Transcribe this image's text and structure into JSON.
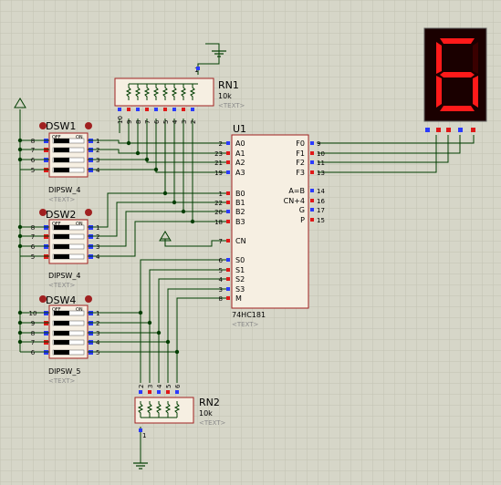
{
  "colors": {
    "background": "#d6d6c8",
    "grid": "#c2c2b2",
    "wire": "#003d00",
    "chip_fill": "#f6efe2",
    "chip_border": "#a02020",
    "pin_blue": "#2a3aff",
    "pin_red": "#e01818",
    "segment_on": "#ff1a1a",
    "segment_off": "#3a0000",
    "display_bg": "#1a0000",
    "text_label": "#000000",
    "text_placeholder": "#8a8a8a",
    "switch_knob": "#000000"
  },
  "rn1": {
    "ref": "RN1",
    "value": "10k",
    "placeholder": "<TEXT>",
    "pin_numbers": [
      "10",
      "9",
      "8",
      "7",
      "6",
      "5",
      "4",
      "3",
      "2"
    ],
    "common_pin": "1"
  },
  "rn2": {
    "ref": "RN2",
    "value": "10k",
    "placeholder": "<TEXT>",
    "pin_numbers": [
      "2",
      "3",
      "4",
      "5",
      "6"
    ],
    "common_pin": "1"
  },
  "u1": {
    "ref": "U1",
    "part": "74HC181",
    "placeholder": "<TEXT>",
    "left_pins": [
      {
        "num": "2",
        "name": "A0"
      },
      {
        "num": "23",
        "name": "A1"
      },
      {
        "num": "21",
        "name": "A2"
      },
      {
        "num": "19",
        "name": "A3"
      },
      {
        "num": "1",
        "name": "B0"
      },
      {
        "num": "22",
        "name": "B1"
      },
      {
        "num": "20",
        "name": "B2"
      },
      {
        "num": "18",
        "name": "B3"
      },
      {
        "num": "7",
        "name": "CN"
      },
      {
        "num": "6",
        "name": "S0"
      },
      {
        "num": "5",
        "name": "S1"
      },
      {
        "num": "4",
        "name": "S2"
      },
      {
        "num": "3",
        "name": "S3"
      },
      {
        "num": "8",
        "name": "M"
      }
    ],
    "right_pins": [
      {
        "num": "9",
        "name": "F0"
      },
      {
        "num": "10",
        "name": "F1"
      },
      {
        "num": "11",
        "name": "F2"
      },
      {
        "num": "13",
        "name": "F3"
      },
      {
        "num": "14",
        "name": "A=B"
      },
      {
        "num": "16",
        "name": "CN+4"
      },
      {
        "num": "17",
        "name": "G"
      },
      {
        "num": "15",
        "name": "P"
      }
    ]
  },
  "dsw1": {
    "ref": "DSW1",
    "part": "DIPSW_4",
    "placeholder": "<TEXT>",
    "off_label": "OFF",
    "on_label": "ON",
    "left_pins": [
      "8",
      "7",
      "6",
      "5"
    ],
    "right_pins": [
      "1",
      "2",
      "3",
      "4"
    ]
  },
  "dsw2": {
    "ref": "DSW2",
    "part": "DIPSW_4",
    "placeholder": "<TEXT>",
    "off_label": "OFF",
    "on_label": "ON",
    "left_pins": [
      "8",
      "7",
      "6",
      "5"
    ],
    "right_pins": [
      "1",
      "2",
      "3",
      "4"
    ]
  },
  "dsw4": {
    "ref": "DSW4",
    "part": "DIPSW_5",
    "placeholder": "<TEXT>",
    "off_label": "OFF",
    "on_label": "ON",
    "left_pins": [
      "10",
      "9",
      "8",
      "7",
      "6"
    ],
    "right_pins": [
      "1",
      "2",
      "3",
      "4",
      "5"
    ]
  },
  "display": {
    "digit": "6"
  }
}
